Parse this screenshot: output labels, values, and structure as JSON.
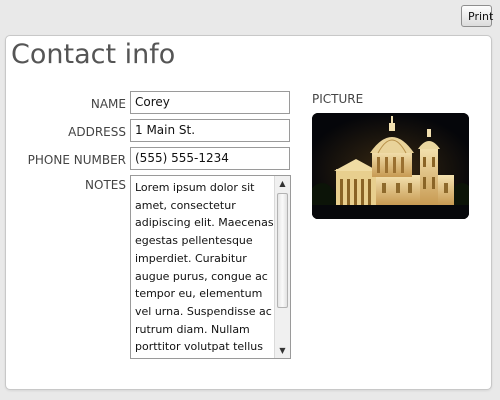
{
  "toolbar": {
    "print_label": "Print"
  },
  "form": {
    "title": "Contact info",
    "name": {
      "label": "NAME",
      "value": "Corey"
    },
    "address": {
      "label": "ADDRESS",
      "value": "1 Main St."
    },
    "phone": {
      "label": "PHONE NUMBER",
      "value": "(555) 555-1234"
    },
    "notes": {
      "label": "NOTES",
      "value": "Lorem ipsum dolor sit\namet, consectetur\nadipiscing elit. Maecenas\negestas pellentesque\nimperdiet. Curabitur\naugue purus, congue ac\ntempor eu, elementum\nvel urna. Suspendisse ac\nrutrum diam. Nullam\nporttitor volutpat tellus in\nconsequat. Donec"
    },
    "picture": {
      "label": "PICTURE"
    }
  },
  "colors": {
    "page_background": "#e9e9e9",
    "card_background": "#ffffff",
    "title_text": "#555555"
  },
  "icons": {
    "scroll_up": "triangle-up",
    "scroll_down": "triangle-down"
  }
}
